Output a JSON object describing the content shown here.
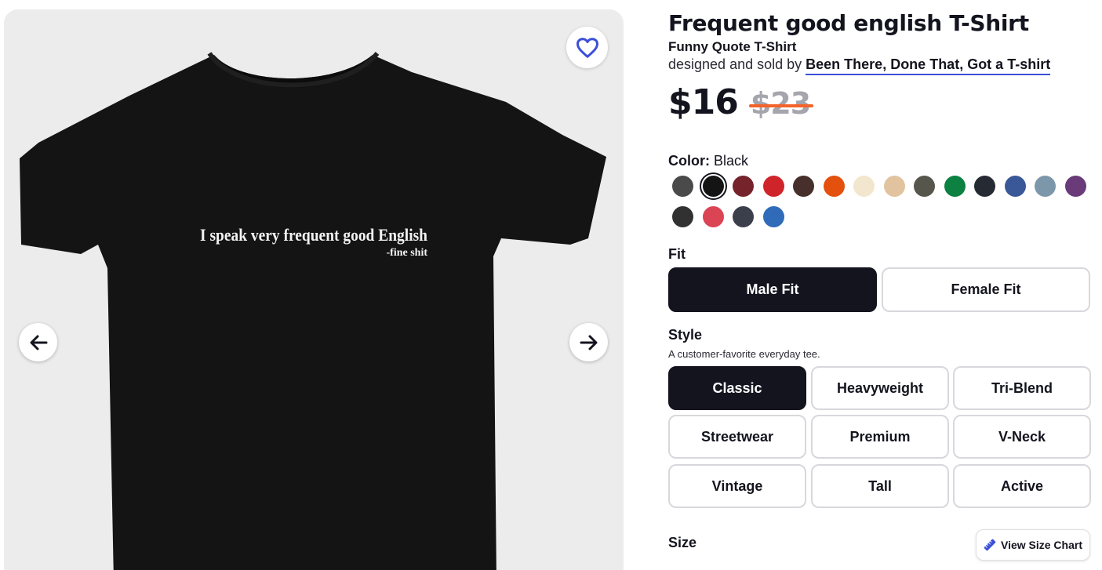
{
  "product": {
    "title": "Frequent good english T-Shirt",
    "type": "Funny Quote T-Shirt",
    "byline_prefix": "designed and sold by",
    "artist": "Been There, Done That, Got a T-shirt",
    "price_now": "$16",
    "price_old": "$23"
  },
  "gallery": {
    "shirt_color": "#141414",
    "print_line1": "I speak very frequent good English",
    "print_line2": "-fine shit",
    "favorite_icon": "heart-icon",
    "prev_icon": "arrow-left-icon",
    "next_icon": "arrow-right-icon"
  },
  "color": {
    "label": "Color:",
    "selected": "Black",
    "swatches": [
      "#4a4a4a",
      "#141414",
      "#76232b",
      "#d0242b",
      "#47302b",
      "#e4500d",
      "#f3e6ce",
      "#e2c39f",
      "#56564c",
      "#0c8141",
      "#262b33",
      "#3a5897",
      "#7c97a9",
      "#693c79",
      "#313131",
      "#db4454",
      "#3b3f4b",
      "#2f6bb8"
    ]
  },
  "fit": {
    "label": "Fit",
    "options": [
      "Male Fit",
      "Female Fit"
    ],
    "selected": "Male Fit"
  },
  "style": {
    "label": "Style",
    "description": "A customer-favorite everyday tee.",
    "options": [
      "Classic",
      "Heavyweight",
      "Tri-Blend",
      "Streetwear",
      "Premium",
      "V-Neck",
      "Vintage",
      "Tall",
      "Active"
    ],
    "selected": "Classic"
  },
  "size": {
    "label": "Size",
    "chart_button": "View Size Chart",
    "chart_icon": "ruler-icon",
    "accent": "#3b4fd8"
  }
}
